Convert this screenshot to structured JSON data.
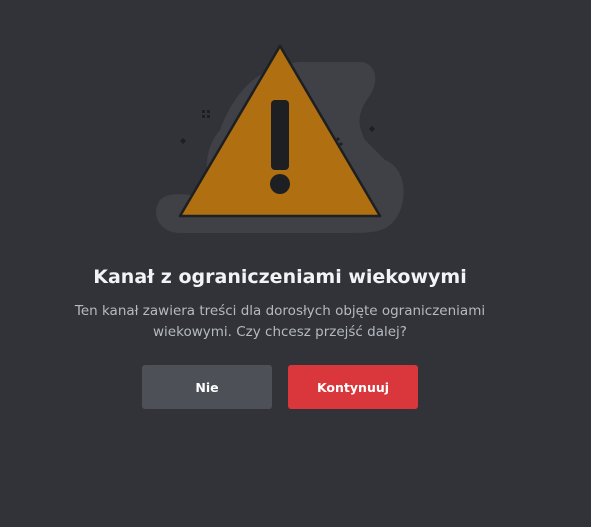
{
  "dialog": {
    "title": "Kanał z ograniczeniami wiekowymi",
    "description_line1": "Ten kanał zawiera treści dla dorosłych objęte ograniczeniami",
    "description_line2": "wiekowymi. Czy chcesz przejść dalej?",
    "decline_label": "Nie",
    "confirm_label": "Kontynuuj"
  },
  "icons": {
    "illustration": "warning-triangle-icon"
  },
  "colors": {
    "background": "#313338",
    "warning": "#b07012",
    "confirm": "#da373c",
    "decline": "#4e5058"
  }
}
